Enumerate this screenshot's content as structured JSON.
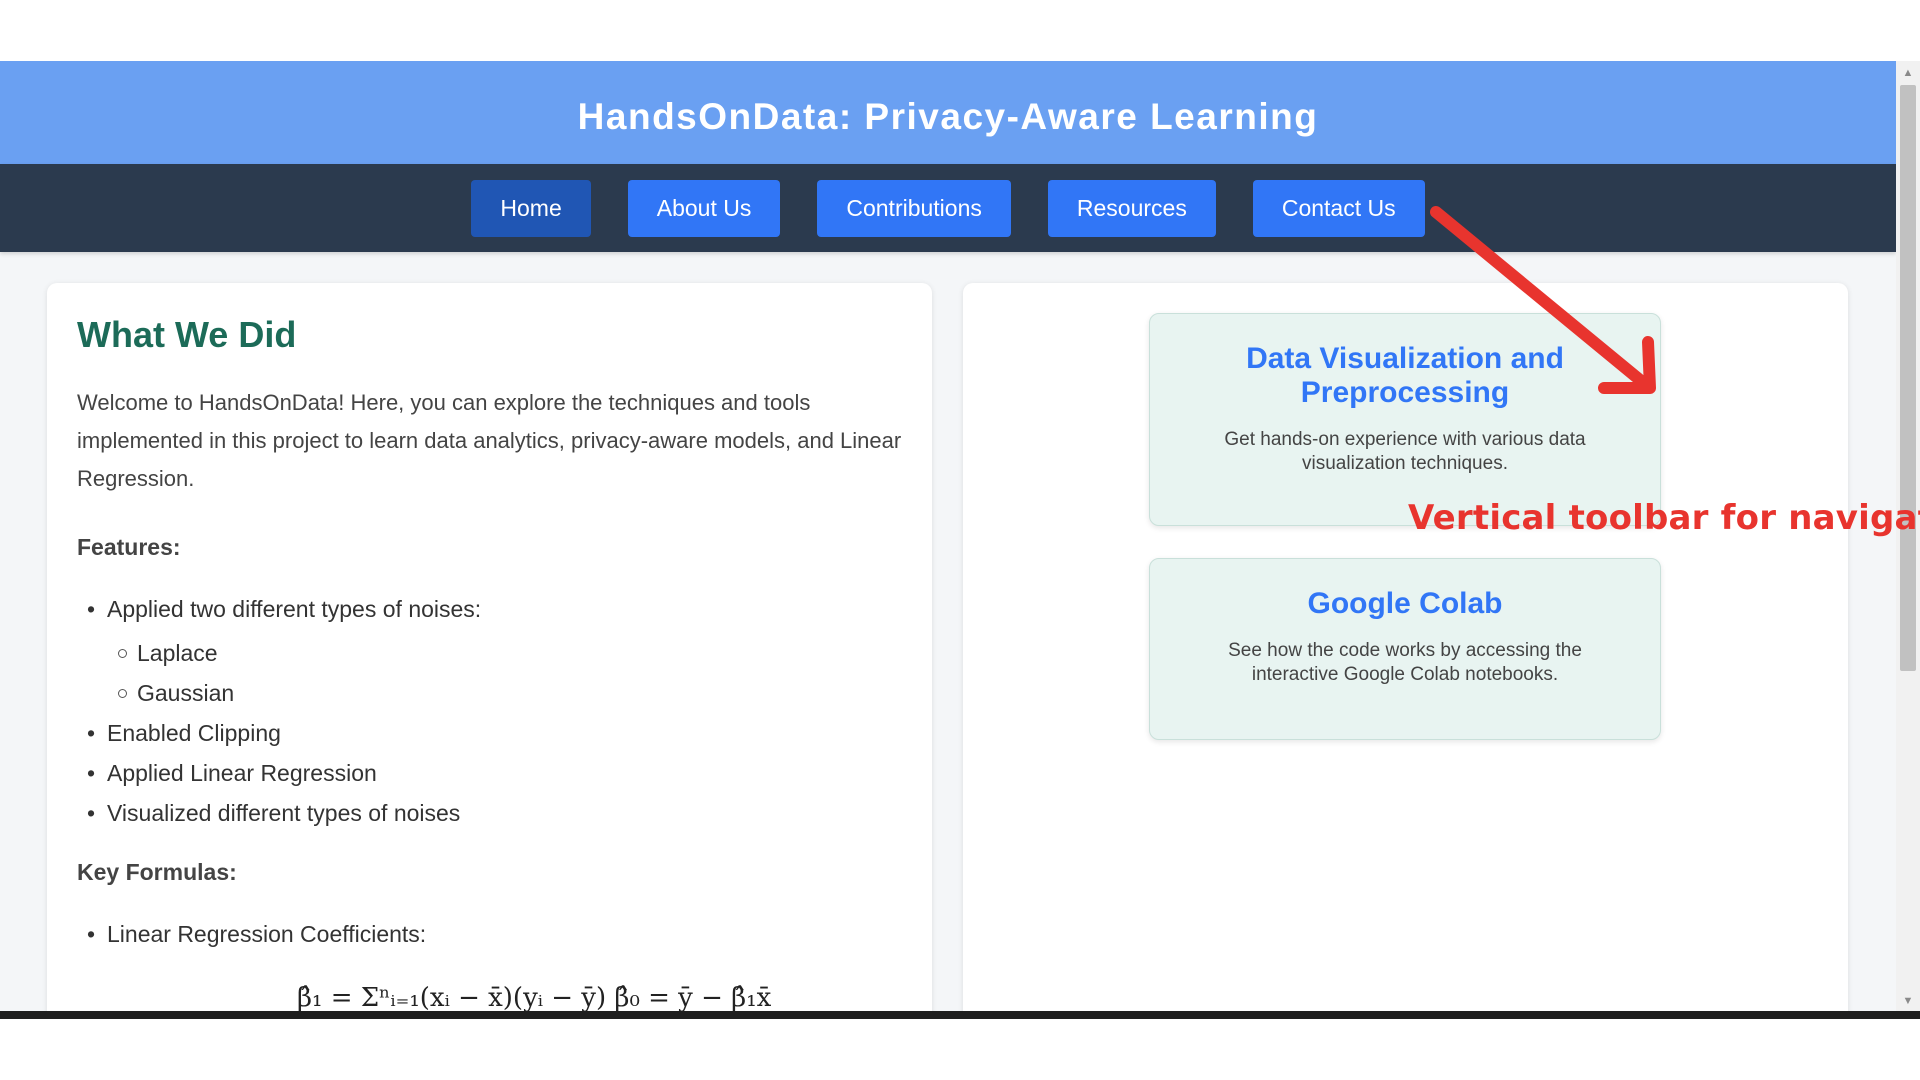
{
  "site": {
    "title": "HandsOnData: Privacy-Aware Learning"
  },
  "nav": {
    "items": [
      {
        "label": "Home",
        "active": true
      },
      {
        "label": "About Us",
        "active": false
      },
      {
        "label": "Contributions",
        "active": false
      },
      {
        "label": "Resources",
        "active": false
      },
      {
        "label": "Contact Us",
        "active": false
      }
    ]
  },
  "main": {
    "title": "What We Did",
    "intro": "Welcome to HandsOnData! Here, you can explore the techniques and tools implemented in this project to learn data analytics, privacy-aware models, and Linear Regression.",
    "features_heading": "Features:",
    "features": {
      "noises": "Applied two different types of noises:",
      "noise_types": [
        "Laplace",
        "Gaussian"
      ],
      "clipping": "Enabled Clipping",
      "regression": "Applied Linear Regression",
      "visualized": "Visualized different types of noises"
    },
    "formulas_heading": "Key Formulas:",
    "formulas": {
      "coefficients": "Linear Regression Coefficients:",
      "expression": "β̂₁ = Σⁿᵢ₌₁(xᵢ − x̄)(yᵢ − ȳ)   β̂₀ = ȳ − β̂₁x̄"
    }
  },
  "cards": [
    {
      "title": "Data Visualization and Preprocessing",
      "description": "Get hands-on experience with various data visualization techniques."
    },
    {
      "title": "Google Colab",
      "description": "See how the code works by accessing the interactive Google Colab notebooks."
    }
  ],
  "annotation": {
    "text": "Vertical toolbar for navigation"
  },
  "colors": {
    "header_bg": "#6aa0f2",
    "nav_bg": "#2b3a4e",
    "nav_button": "#3176f6",
    "nav_button_active": "#2056b4",
    "section_title": "#1c6b58",
    "card_bg": "#e8f4f1",
    "annotation": "#e8342e"
  }
}
